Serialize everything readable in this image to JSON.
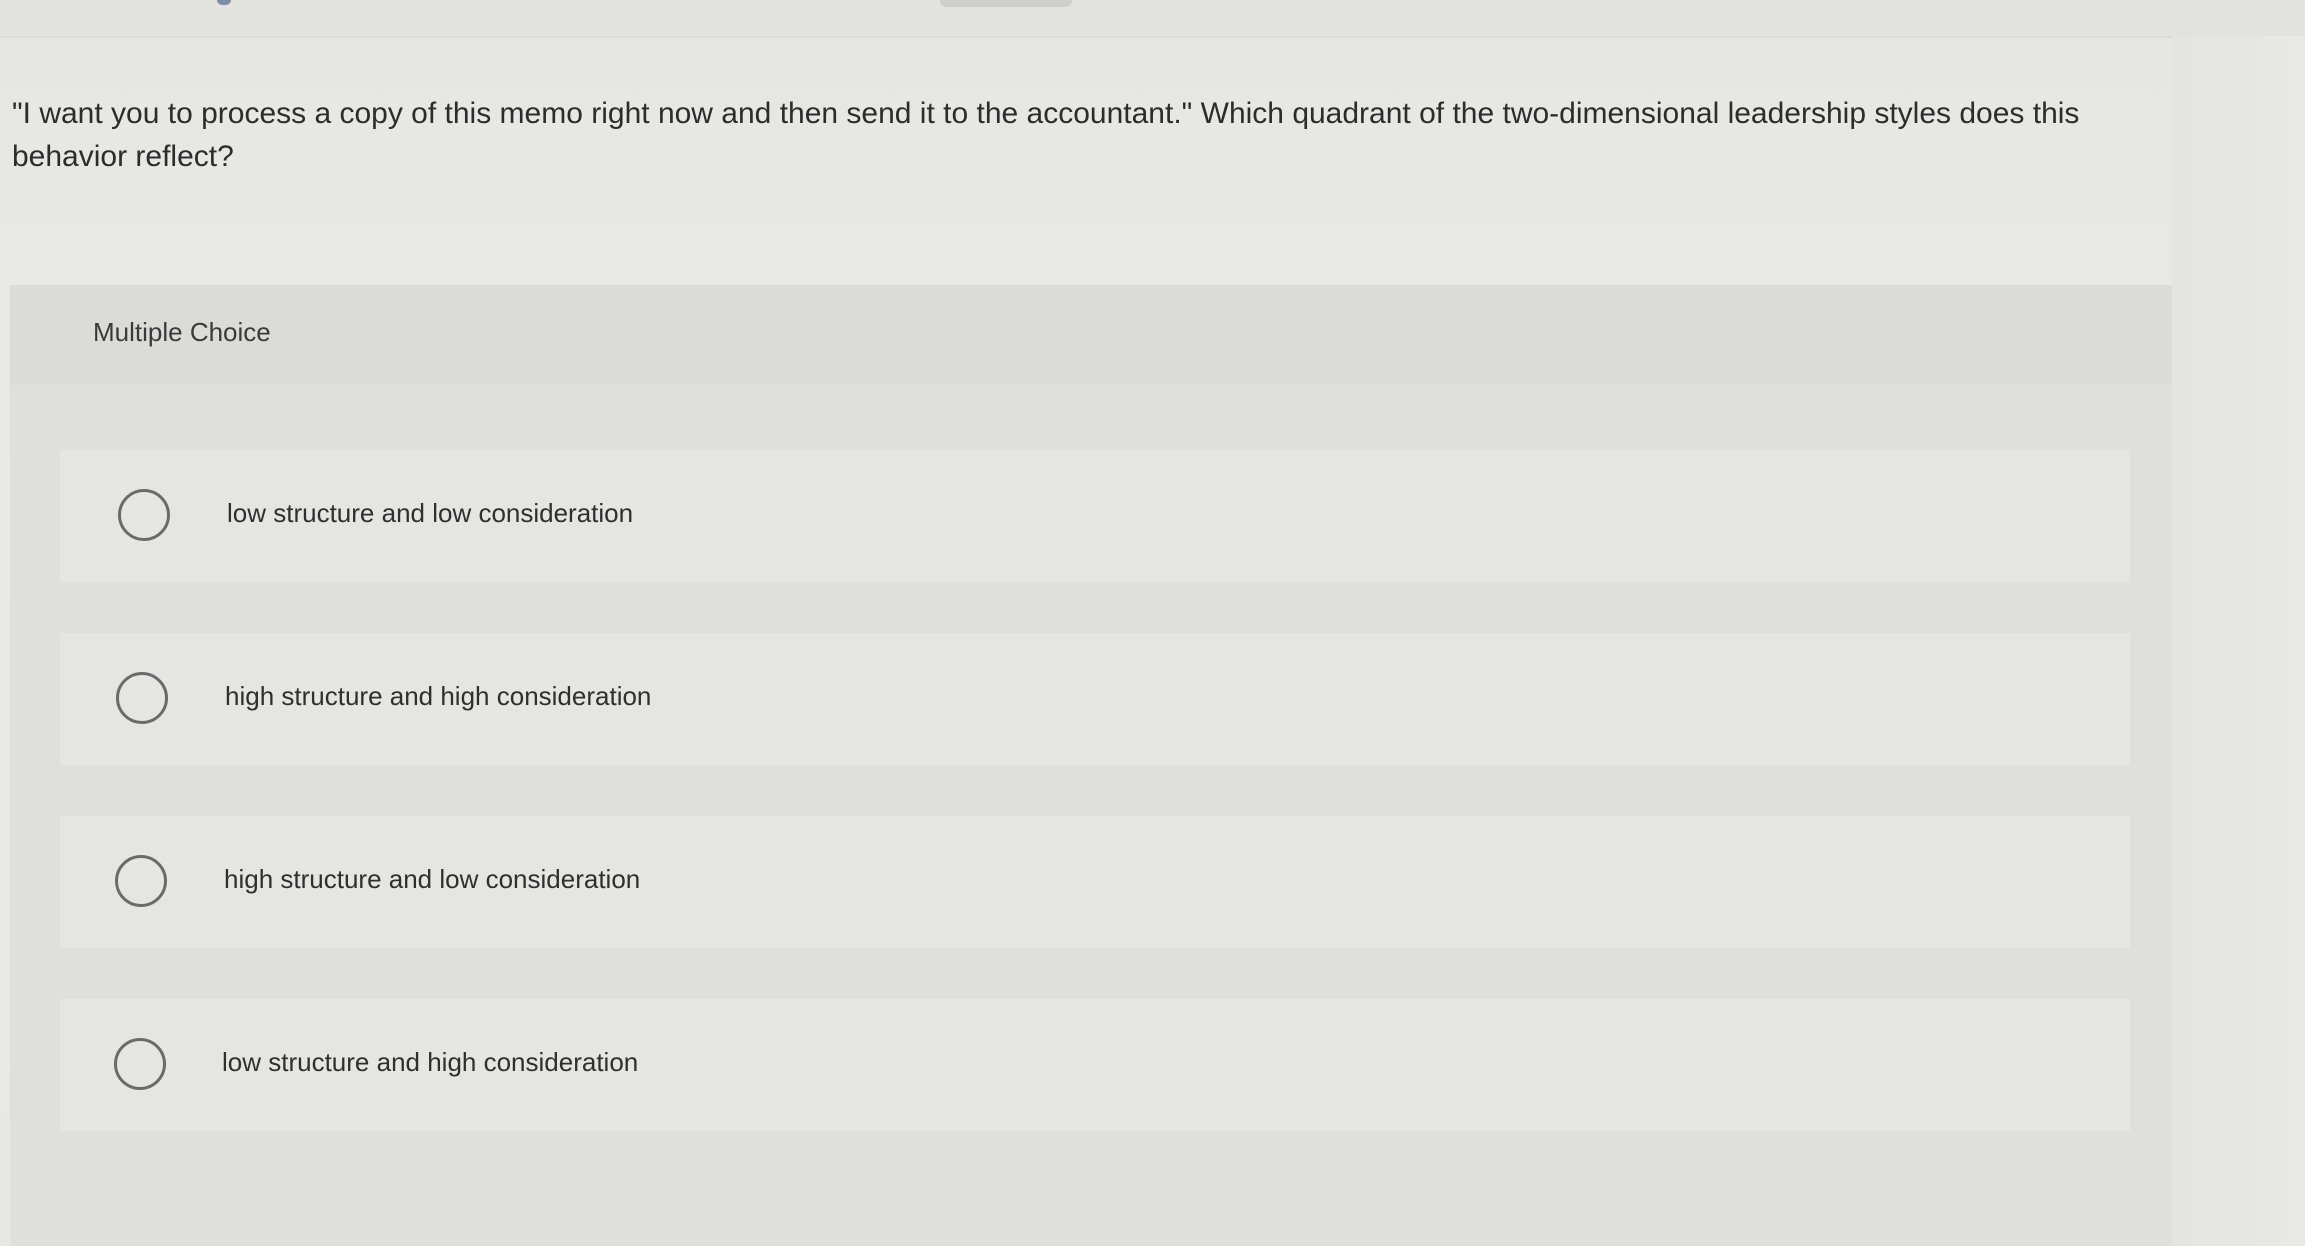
{
  "question": {
    "text": "\"I want you to process a copy of this memo right now and then send it to the accountant.\" Which quadrant of the two-dimensional leadership styles does this behavior reflect?"
  },
  "multiple_choice": {
    "label": "Multiple Choice",
    "options": [
      {
        "label": "low structure and low consideration",
        "selected": false
      },
      {
        "label": "high structure and high consideration",
        "selected": false
      },
      {
        "label": "high structure and low consideration",
        "selected": false
      },
      {
        "label": "low structure and high consideration",
        "selected": false
      }
    ]
  },
  "colors": {
    "background": "#e8e8e4",
    "panel": "#dfdfdc",
    "option_bg": "#e5e5e2",
    "text": "#2f2f2f",
    "radio_border": "#6a6a6a"
  },
  "icons": [
    "radio-button-unchecked-icon"
  ]
}
